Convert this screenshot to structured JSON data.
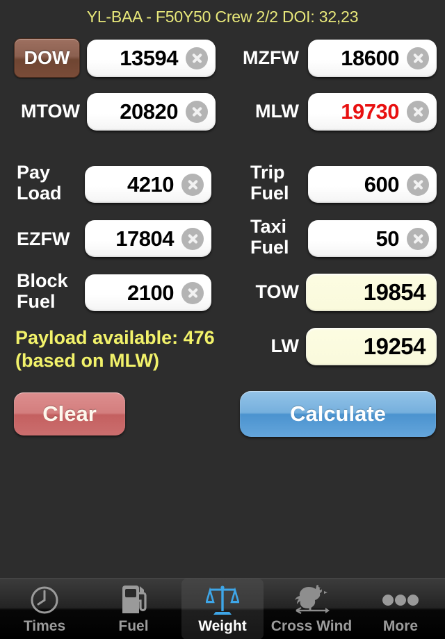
{
  "app": {
    "title": "YL-BAA - F50Y50 Crew 2/2 DOI: 32,23"
  },
  "colors": {
    "background": "#2d2d2d",
    "title_text": "#e8e87a",
    "warning_text": "#f2f26a",
    "over_limit_value": "#e81010",
    "computed_field_bg": "#fafadc",
    "dow_button": "#7a4c38",
    "clear_button": "#cb6e6e",
    "calculate_button": "#64a5db",
    "active_tab_icon": "#3ea6e8"
  },
  "form": {
    "rows_top": [
      {
        "key": "dow",
        "label": "DOW",
        "label_is_button": true,
        "value": "13594",
        "editable": true,
        "over_limit": false,
        "clear_icon": "clear-circle-icon"
      },
      {
        "key": "mzfw",
        "label": "MZFW",
        "label_is_button": false,
        "value": "18600",
        "editable": true,
        "over_limit": false,
        "clear_icon": "clear-circle-icon"
      },
      {
        "key": "mtow",
        "label": "MTOW",
        "label_is_button": false,
        "value": "20820",
        "editable": true,
        "over_limit": false,
        "clear_icon": "clear-circle-icon"
      },
      {
        "key": "mlw",
        "label": "MLW",
        "label_is_button": false,
        "value": "19730",
        "editable": true,
        "over_limit": true,
        "clear_icon": "clear-circle-icon"
      }
    ],
    "rows_main_left": [
      {
        "key": "payload",
        "label": "Pay\nLoad",
        "value": "4210",
        "editable": true,
        "clear_icon": "clear-circle-icon"
      },
      {
        "key": "ezfw",
        "label": "EZFW",
        "value": "17804",
        "editable": true,
        "clear_icon": "clear-circle-icon"
      },
      {
        "key": "block_fuel",
        "label": "Block\nFuel",
        "value": "2100",
        "editable": true,
        "clear_icon": "clear-circle-icon"
      }
    ],
    "rows_main_right": [
      {
        "key": "trip_fuel",
        "label": "Trip\nFuel",
        "value": "600",
        "editable": true,
        "readonly": false,
        "clear_icon": "clear-circle-icon"
      },
      {
        "key": "taxi_fuel",
        "label": "Taxi\nFuel",
        "value": "50",
        "editable": true,
        "readonly": false,
        "clear_icon": "clear-circle-icon"
      },
      {
        "key": "tow",
        "label": "TOW",
        "value": "19854",
        "editable": false,
        "readonly": true
      },
      {
        "key": "lw",
        "label": "LW",
        "value": "19254",
        "editable": false,
        "readonly": true
      }
    ],
    "payload_note": "Payload available: 476\n(based on MLW)"
  },
  "actions": {
    "clear_label": "Clear",
    "calculate_label": "Calculate"
  },
  "tabs": [
    {
      "key": "times",
      "label": "Times",
      "icon": "clock-icon",
      "active": false
    },
    {
      "key": "fuel",
      "label": "Fuel",
      "icon": "fuel-pump-icon",
      "active": false
    },
    {
      "key": "weight",
      "label": "Weight",
      "icon": "scales-icon",
      "active": true
    },
    {
      "key": "cross_wind",
      "label": "Cross Wind",
      "icon": "weathervane-icon",
      "active": false
    },
    {
      "key": "more",
      "label": "More",
      "icon": "ellipsis-icon",
      "active": false
    }
  ]
}
